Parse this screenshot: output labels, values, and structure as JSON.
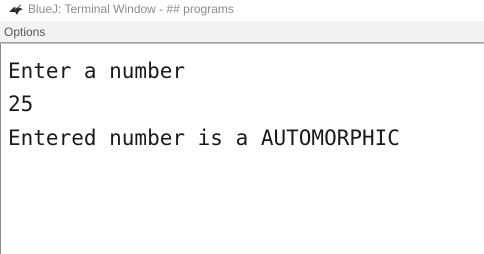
{
  "window": {
    "title": "BlueJ: Terminal Window - ## programs",
    "icon": "bluej-bird-icon"
  },
  "menubar": {
    "options_label": "Options"
  },
  "terminal": {
    "lines": [
      "Enter a number",
      "25",
      "Entered number is a AUTOMORPHIC"
    ]
  },
  "colors": {
    "title_text": "#8c8c8c",
    "menubar_bg": "#f3f3f3",
    "terminal_text": "#1a1a1a"
  }
}
